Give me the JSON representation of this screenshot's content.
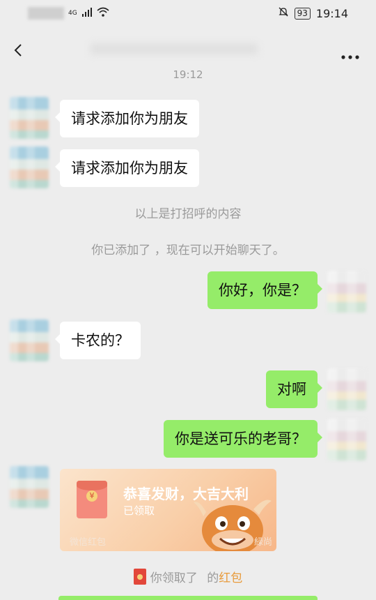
{
  "status_bar": {
    "network": "4G",
    "battery": "93",
    "time": "19:14"
  },
  "navbar": {
    "title": "",
    "more_label": "•••"
  },
  "chat_time": "19:12",
  "messages": [
    {
      "side": "left",
      "text": "请求添加你为朋友"
    },
    {
      "side": "left",
      "text": "请求添加你为朋友"
    },
    {
      "side": "right",
      "text": "你好，你是？"
    },
    {
      "side": "left",
      "text": "卡农的？"
    },
    {
      "side": "right",
      "text": "对啊"
    },
    {
      "side": "right",
      "text": "你是送可乐的老哥？"
    }
  ],
  "system_notes": [
    "以上是打招呼的内容",
    "你已添加了 ，现在可以开始聊天了。"
  ],
  "red_packet": {
    "title": "恭喜发财，大吉大利",
    "status": "已领取",
    "footer": "微信红包",
    "footer_suffix": "緑尚"
  },
  "receipt_notice": {
    "prefix": "你领取了",
    "middle": " 的",
    "link": "红包"
  },
  "colors": {
    "background": "#ededed",
    "my_bubble": "#95ec69",
    "their_bubble": "#ffffff",
    "red_packet": "#f9cfa9",
    "link": "#e89a3a"
  }
}
